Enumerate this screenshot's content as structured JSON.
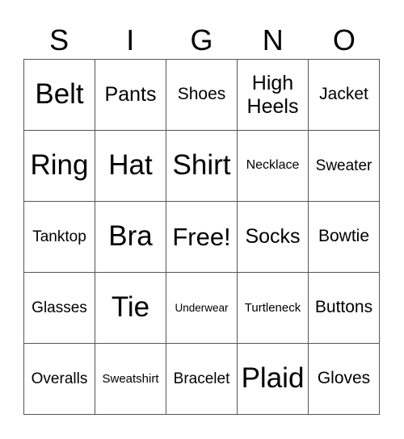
{
  "header": [
    "S",
    "I",
    "G",
    "N",
    "O"
  ],
  "cells": [
    [
      {
        "text": "Belt",
        "size": "s-xl"
      },
      {
        "text": "Pants",
        "size": "s-m"
      },
      {
        "text": "Shoes",
        "size": "s-s"
      },
      {
        "text": "High Heels",
        "size": "s-m"
      },
      {
        "text": "Jacket",
        "size": "s-s"
      }
    ],
    [
      {
        "text": "Ring",
        "size": "s-xl"
      },
      {
        "text": "Hat",
        "size": "s-xl"
      },
      {
        "text": "Shirt",
        "size": "s-xl"
      },
      {
        "text": "Necklace",
        "size": "s-xxs"
      },
      {
        "text": "Sweater",
        "size": "s-xs"
      }
    ],
    [
      {
        "text": "Tanktop",
        "size": "s-xs"
      },
      {
        "text": "Bra",
        "size": "s-xl"
      },
      {
        "text": "Free!",
        "size": "s-l"
      },
      {
        "text": "Socks",
        "size": "s-m"
      },
      {
        "text": "Bowtie",
        "size": "s-s"
      }
    ],
    [
      {
        "text": "Glasses",
        "size": "s-xs"
      },
      {
        "text": "Tie",
        "size": "s-xl"
      },
      {
        "text": "Underwear",
        "size": "s-tt"
      },
      {
        "text": "Turtleneck",
        "size": "s-t"
      },
      {
        "text": "Buttons",
        "size": "s-s"
      }
    ],
    [
      {
        "text": "Overalls",
        "size": "s-xs"
      },
      {
        "text": "Sweatshirt",
        "size": "s-t"
      },
      {
        "text": "Bracelet",
        "size": "s-xs"
      },
      {
        "text": "Plaid",
        "size": "s-xl"
      },
      {
        "text": "Gloves",
        "size": "s-s"
      }
    ]
  ]
}
